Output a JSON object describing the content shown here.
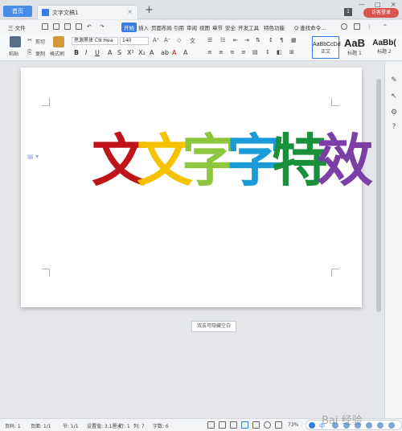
{
  "titlebar": {
    "home_tab": "首页",
    "doc_tab": "文字文稿1",
    "close_tab": "×",
    "new_tab": "+",
    "badge": "1",
    "login": "访客登录",
    "minimize": "—",
    "maximize": "□",
    "close": "×"
  },
  "menubar": {
    "file": "三 文件",
    "items": [
      "开始",
      "插入",
      "页面布局",
      "引用",
      "审阅",
      "视图",
      "章节",
      "安全",
      "开发工具",
      "特色功能"
    ],
    "search": "Q 查找命令..."
  },
  "ribbon": {
    "cut": "剪切",
    "copy": "复制",
    "paste": "粘贴",
    "format_painter": "格式刷",
    "font_name": "思源黑体 CN Hea",
    "font_size": "140",
    "styles": [
      {
        "preview": "AaBbCcDd",
        "label": "正文"
      },
      {
        "preview": "AaB",
        "label": "标题 1"
      },
      {
        "preview": "AaBb(",
        "label": "标题 2"
      }
    ]
  },
  "document": {
    "art_chars": [
      {
        "char": "文",
        "color": "#c0141b"
      },
      {
        "char": "文",
        "color": "#f6c200"
      },
      {
        "char": "字",
        "color": "#8dc63f"
      },
      {
        "char": "字",
        "color": "#1a9ad7"
      },
      {
        "char": "特",
        "color": "#1a8f3c"
      },
      {
        "char": "效",
        "color": "#7b3fa6"
      }
    ],
    "hide_blank": "双击可隐藏空白"
  },
  "statusbar": {
    "page_num": "页码: 1",
    "pages": "页面: 1/1",
    "section": "节: 1/1",
    "setting": "设置值: 3.1厘米",
    "row": "行: 1",
    "col": "列: 7",
    "words": "字数: 6",
    "zoom": "73%"
  },
  "watermark": "Bai 经验",
  "ime": "中"
}
